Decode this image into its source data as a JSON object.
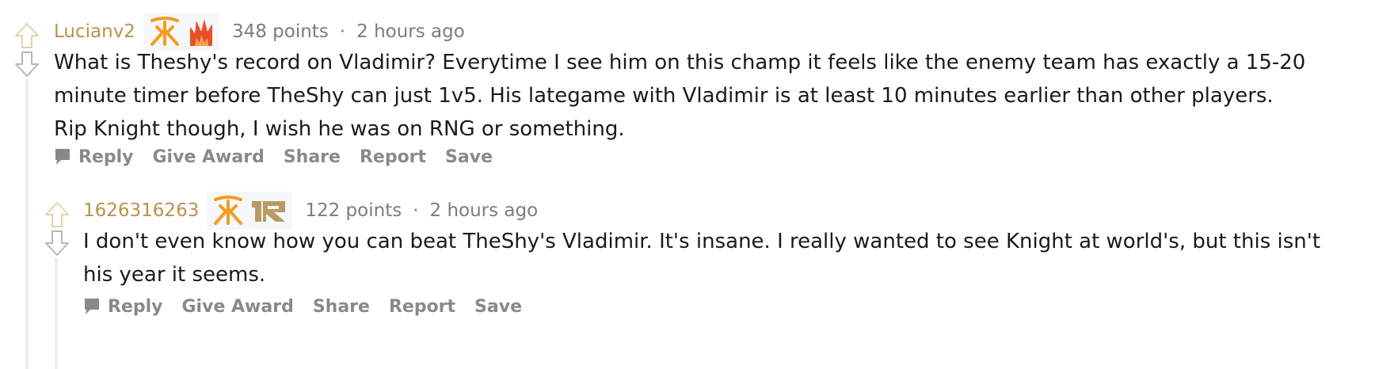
{
  "comments": [
    {
      "author": "Lucianv2",
      "flair_icons": [
        "fnatic-logo-icon",
        "flame-logo-icon"
      ],
      "points": "348 points",
      "separator": "·",
      "time": "2 hours ago",
      "body": [
        "What is Theshy's record on Vladimir? Everytime I see him on this champ it feels like the enemy team has exactly a 15-20",
        "minute timer before TheShy can just 1v5. His lategame with Vladimir is at least 10 minutes earlier than other players.",
        "Rip Knight though, I wish he was on RNG or something."
      ],
      "actions": {
        "reply": "Reply",
        "give_award": "Give Award",
        "share": "Share",
        "report": "Report",
        "save": "Save"
      }
    },
    {
      "author": "1626316263",
      "flair_icons": [
        "fnatic-logo-icon",
        "rng-logo-icon"
      ],
      "points": "122 points",
      "separator": "·",
      "time": "2 hours ago",
      "body": [
        "I don't even know how you can beat TheShy's Vladimir. It's insane. I really wanted to see Knight at world's, but this isn't",
        "his year it seems."
      ],
      "actions": {
        "reply": "Reply",
        "give_award": "Give Award",
        "share": "Share",
        "report": "Report",
        "save": "Save"
      }
    }
  ],
  "colors": {
    "author": "#b9924b",
    "meta": "#7c7c7c",
    "action": "#878a8c",
    "thread_line": "#edeff1",
    "fnatic_orange": "#f39c1f",
    "flame_red": "#e8502a",
    "rng_tan": "#b99a63"
  }
}
